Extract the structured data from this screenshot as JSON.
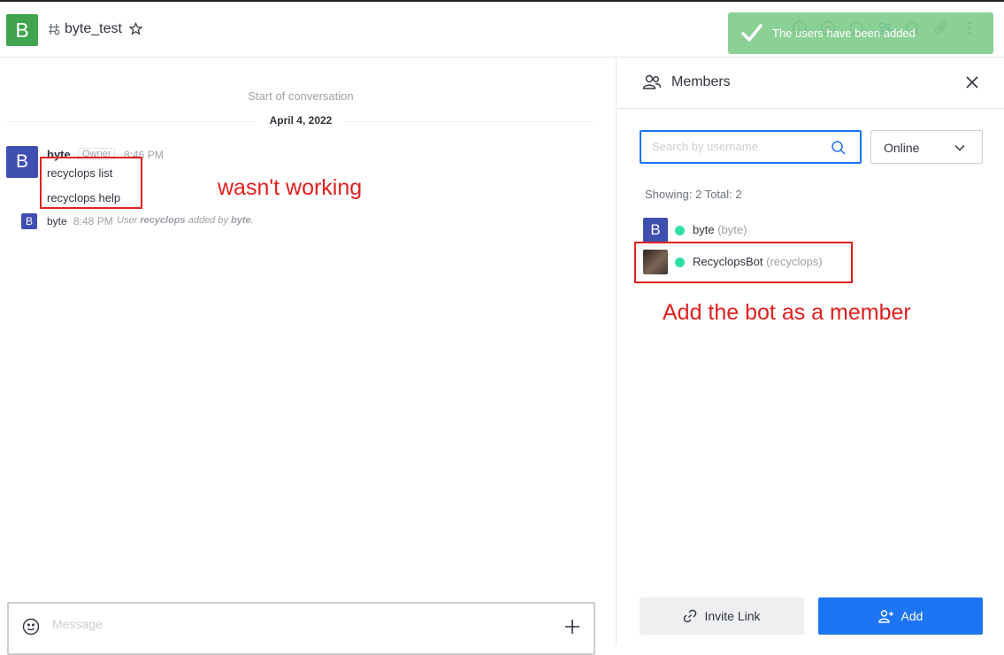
{
  "header": {
    "room_avatar_letter": "B",
    "room_name": "byte_test"
  },
  "toast": {
    "text": "The users have been added"
  },
  "chat": {
    "start_label": "Start of conversation",
    "date": "April 4, 2022",
    "message": {
      "avatar_letter": "B",
      "user": "byte",
      "role": "Owner",
      "time": "8:46 PM",
      "lines": [
        "recyclops list",
        "recyclops help"
      ]
    },
    "system": {
      "avatar_letter": "B",
      "user": "byte",
      "time": "8:48 PM",
      "prefix": "User ",
      "target": "recyclops",
      "middle": " added by ",
      "actor": "byte",
      "suffix": "."
    },
    "annotation": "wasn't working"
  },
  "composer": {
    "placeholder": "Message"
  },
  "members_panel": {
    "title": "Members",
    "search_placeholder": "Search by username",
    "filter_value": "Online",
    "counts": "Showing: 2  Total: 2",
    "members": [
      {
        "avatar_letter": "B",
        "avatar_color": "#3f4fb0",
        "name": "byte",
        "username": "(byte)",
        "status_color": "#2de0a5"
      },
      {
        "avatar_letter": "",
        "avatar_color": "#5a4a40",
        "name": "RecyclopsBot",
        "username": "(recyclops)",
        "status_color": "#2de0a5"
      }
    ],
    "annotation": "Add the bot as a member",
    "invite_label": "Invite Link",
    "add_label": "Add"
  },
  "colors": {
    "accent": "#1d74f5",
    "annotation": "#e0201f",
    "room_avatar": "#3fa44d",
    "toast": "#7ccb88"
  }
}
